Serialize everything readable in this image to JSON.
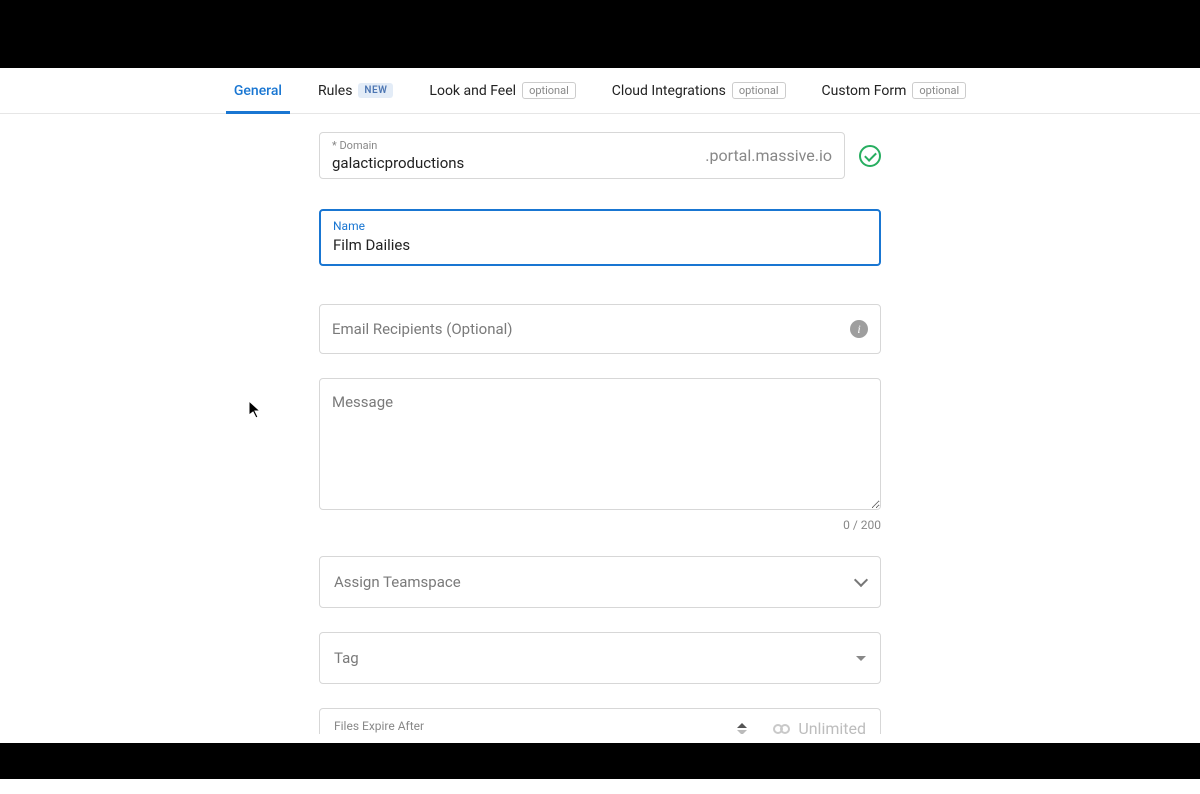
{
  "tabs": [
    {
      "label": "General",
      "badge": null
    },
    {
      "label": "Rules",
      "badge": {
        "text": "NEW",
        "kind": "new"
      }
    },
    {
      "label": "Look and Feel",
      "badge": {
        "text": "optional",
        "kind": "opt"
      }
    },
    {
      "label": "Cloud Integrations",
      "badge": {
        "text": "optional",
        "kind": "opt"
      }
    },
    {
      "label": "Custom Form",
      "badge": {
        "text": "optional",
        "kind": "opt"
      }
    }
  ],
  "domain": {
    "label": "* Domain",
    "value": "galacticproductions",
    "suffix": ".portal.massive.io"
  },
  "name": {
    "label": "Name",
    "value": "Film Dailies"
  },
  "emailRecipients": {
    "placeholder": "Email Recipients (Optional)"
  },
  "message": {
    "placeholder": "Message",
    "counter": "0 / 200"
  },
  "teamspace": {
    "placeholder": "Assign Teamspace"
  },
  "tag": {
    "placeholder": "Tag"
  },
  "expire": {
    "label": "Files Expire After",
    "valueText": "Unlimited"
  }
}
